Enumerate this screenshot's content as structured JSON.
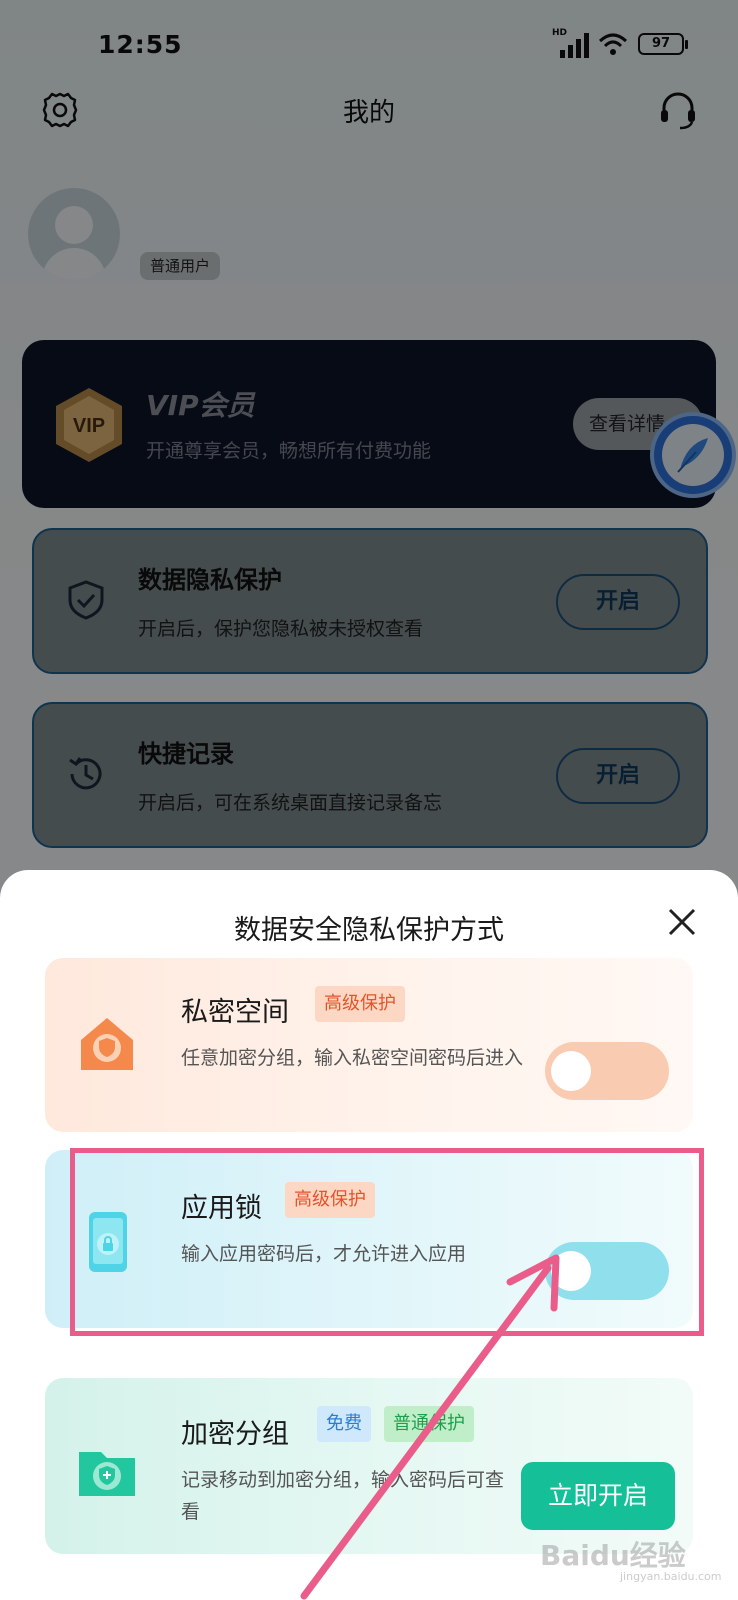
{
  "status_bar": {
    "time": "12:55",
    "network": "HD",
    "battery": "97"
  },
  "header": {
    "title": "我的"
  },
  "user": {
    "badge": "普通用户"
  },
  "vip": {
    "title": "VIP会员",
    "badge_text": "VIP",
    "subtitle": "开通尊享会员，畅想所有付费功能",
    "button": "查看详情"
  },
  "features": [
    {
      "title": "数据隐私保护",
      "desc": "开启后，保护您隐私被未授权查看",
      "button": "开启"
    },
    {
      "title": "快捷记录",
      "desc": "开启后，可在系统桌面直接记录备忘",
      "button": "开启"
    }
  ],
  "sheet": {
    "title": "数据安全隐私保护方式",
    "options": [
      {
        "name": "私密空间",
        "tag": "高级保护",
        "desc": "任意加密分组，输入私密空间密码后进入",
        "enabled": false
      },
      {
        "name": "应用锁",
        "tag": "高级保护",
        "desc": "输入应用密码后，才允许进入应用",
        "enabled": false
      },
      {
        "name": "加密分组",
        "tags": [
          "免费",
          "普通保护"
        ],
        "desc": "记录移动到加密分组，输入密码后可查看",
        "button": "立即开启"
      }
    ]
  },
  "watermark": {
    "text": "Baidu经验",
    "sub": "jingyan.baidu.com"
  },
  "colors": {
    "accent_teal": "#15bf98",
    "tag_orange": "#e0552a",
    "highlight": "#ea5d8a"
  }
}
